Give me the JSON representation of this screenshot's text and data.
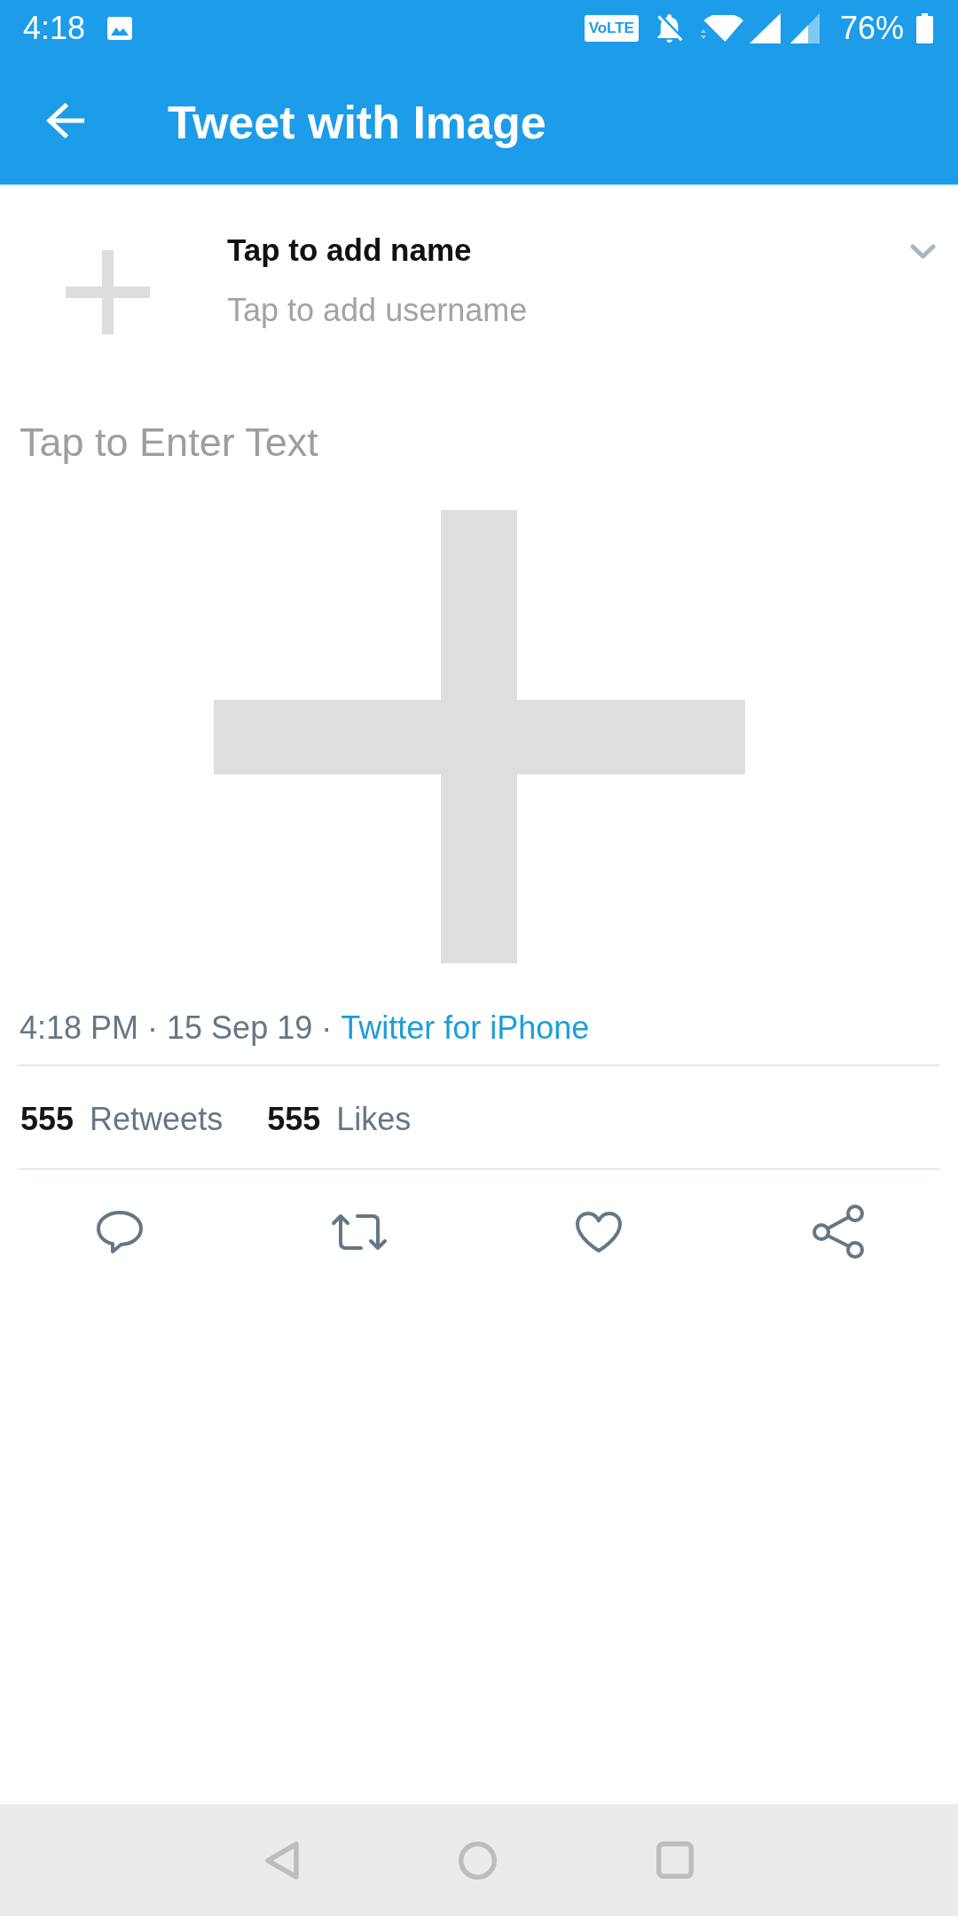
{
  "status_bar": {
    "time": "4:18",
    "network_badge": "VoLTE",
    "battery": "76%"
  },
  "header": {
    "title": "Tweet with Image"
  },
  "profile": {
    "name": "Tap to add name",
    "username": "Tap to add username"
  },
  "tweet": {
    "placeholder": "Tap to Enter Text"
  },
  "meta": {
    "timestamp": "4:18 PM · 15 Sep 19 ·",
    "source": "Twitter for iPhone"
  },
  "stats": [
    {
      "count": "555",
      "label": "Retweets"
    },
    {
      "count": "555",
      "label": "Likes"
    }
  ]
}
